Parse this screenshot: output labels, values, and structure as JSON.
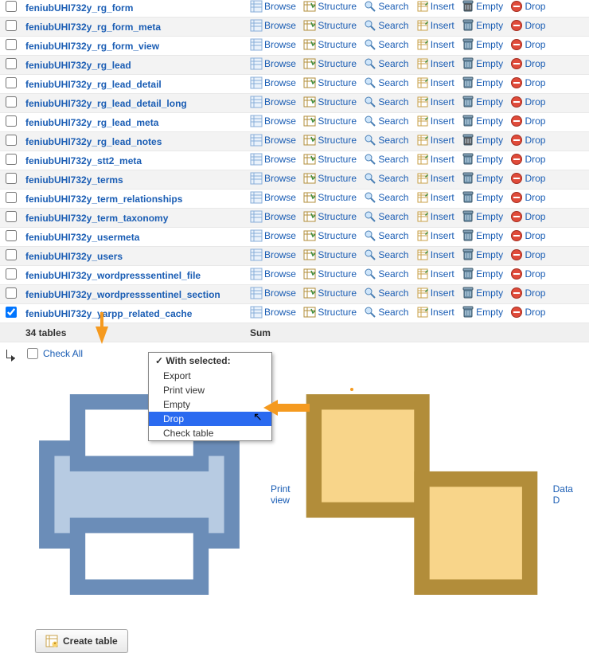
{
  "tables": [
    {
      "name": "feniubUHI732y_rg_form",
      "checked": false,
      "empty_alt": true
    },
    {
      "name": "feniubUHI732y_rg_form_meta",
      "checked": false,
      "empty_alt": false
    },
    {
      "name": "feniubUHI732y_rg_form_view",
      "checked": false,
      "empty_alt": false
    },
    {
      "name": "feniubUHI732y_rg_lead",
      "checked": false,
      "empty_alt": false
    },
    {
      "name": "feniubUHI732y_rg_lead_detail",
      "checked": false,
      "empty_alt": false
    },
    {
      "name": "feniubUHI732y_rg_lead_detail_long",
      "checked": false,
      "empty_alt": false
    },
    {
      "name": "feniubUHI732y_rg_lead_meta",
      "checked": false,
      "empty_alt": false
    },
    {
      "name": "feniubUHI732y_rg_lead_notes",
      "checked": false,
      "empty_alt": true
    },
    {
      "name": "feniubUHI732y_stt2_meta",
      "checked": false,
      "empty_alt": false
    },
    {
      "name": "feniubUHI732y_terms",
      "checked": false,
      "empty_alt": false
    },
    {
      "name": "feniubUHI732y_term_relationships",
      "checked": false,
      "empty_alt": false
    },
    {
      "name": "feniubUHI732y_term_taxonomy",
      "checked": false,
      "empty_alt": false
    },
    {
      "name": "feniubUHI732y_usermeta",
      "checked": false,
      "empty_alt": false
    },
    {
      "name": "feniubUHI732y_users",
      "checked": false,
      "empty_alt": false
    },
    {
      "name": "feniubUHI732y_wordpresssentinel_file",
      "checked": false,
      "empty_alt": false
    },
    {
      "name": "feniubUHI732y_wordpresssentinel_section",
      "checked": false,
      "empty_alt": false
    },
    {
      "name": "feniubUHI732y_yarpp_related_cache",
      "checked": true,
      "empty_alt": false
    }
  ],
  "action_labels": {
    "browse": "Browse",
    "structure": "Structure",
    "search": "Search",
    "insert": "Insert",
    "empty": "Empty",
    "drop": "Drop"
  },
  "summary": {
    "count": "34 tables",
    "sum": "Sum"
  },
  "footer": {
    "check_all": "Check All",
    "print_view": "Print view",
    "data_dictionary": "Data D",
    "create_table": "Create table"
  },
  "dropdown": {
    "header": "With selected:",
    "items": [
      "Export",
      "Print view",
      "Empty",
      "Drop",
      "Check table"
    ],
    "selected_index": 3
  }
}
